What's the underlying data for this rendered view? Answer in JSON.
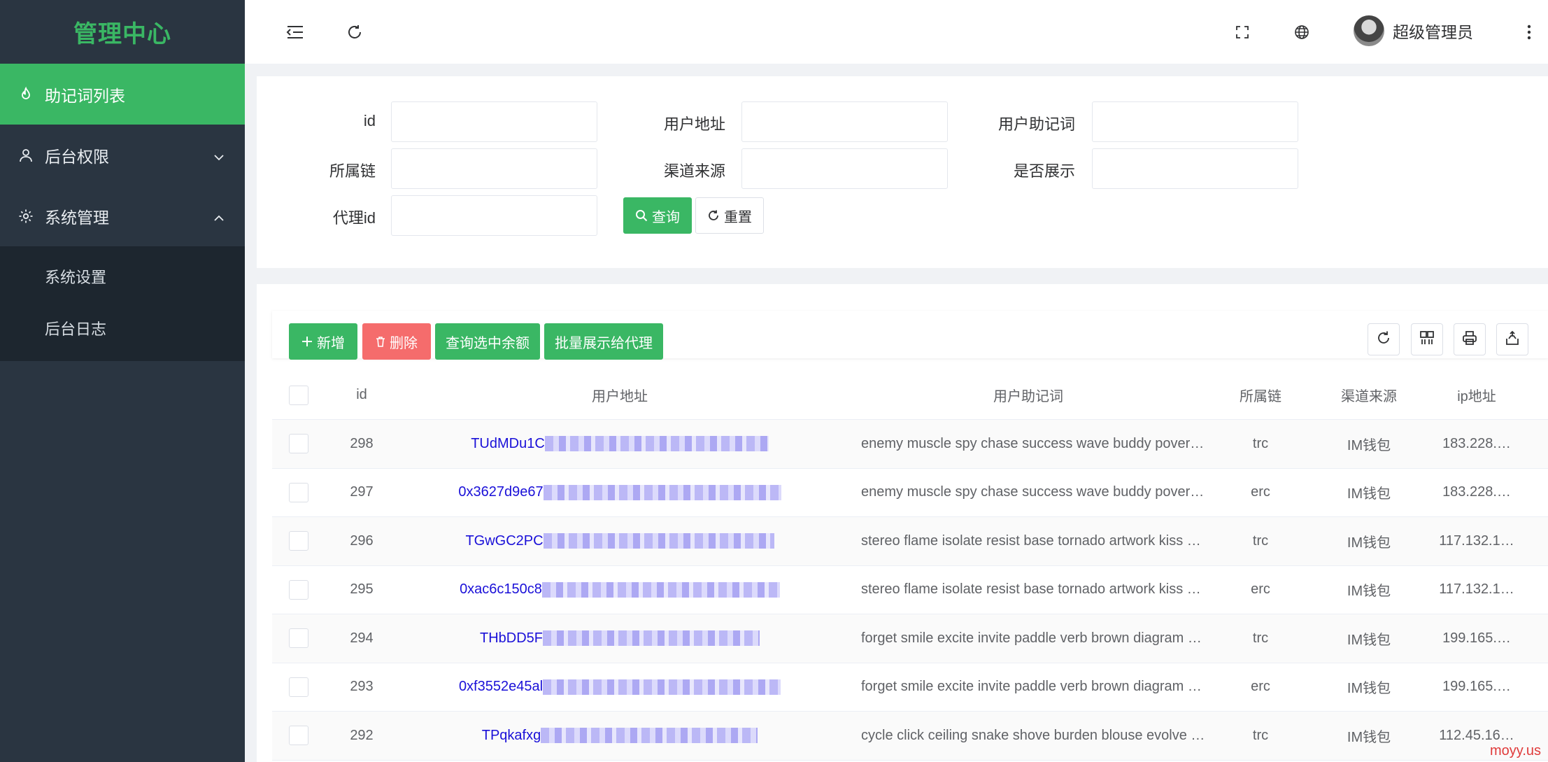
{
  "sidebar": {
    "logo": "管理中心",
    "menu": [
      {
        "label": "助记词列表",
        "icon": "flame-icon",
        "active": true
      },
      {
        "label": "后台权限",
        "icon": "user-icon",
        "expanded": false
      },
      {
        "label": "系统管理",
        "icon": "gear-icon",
        "expanded": true
      }
    ],
    "submenu": [
      {
        "label": "系统设置"
      },
      {
        "label": "后台日志"
      }
    ],
    "colors": {
      "bg": "#2a3541",
      "active": "#3ab764",
      "submenu_bg": "#1d262f"
    }
  },
  "header": {
    "icons": [
      "menu-fold-icon",
      "refresh-icon",
      "fullscreen-icon",
      "globe-icon",
      "more-vertical-icon"
    ],
    "user_name": "超级管理员"
  },
  "search": {
    "fields": [
      {
        "label": "id",
        "value": ""
      },
      {
        "label": "用户地址",
        "value": ""
      },
      {
        "label": "用户助记词",
        "value": ""
      },
      {
        "label": "所属链",
        "value": ""
      },
      {
        "label": "渠道来源",
        "value": ""
      },
      {
        "label": "是否展示",
        "value": ""
      },
      {
        "label": "代理id",
        "value": ""
      }
    ],
    "query_button": "查询",
    "reset_button": "重置"
  },
  "toolbar": {
    "add_button": "新增",
    "delete_button": "删除",
    "query_balance_button": "查询选中余额",
    "batch_show_button": "批量展示给代理",
    "right_icons": [
      "refresh-icon",
      "columns-icon",
      "print-icon",
      "export-icon"
    ]
  },
  "table": {
    "columns": [
      "id",
      "用户地址",
      "用户助记词",
      "所属链",
      "渠道来源",
      "ip地址"
    ],
    "rows": [
      {
        "id": "298",
        "address": "TUdMDu1C",
        "mnemonic": "enemy muscle spy chase success wave buddy pover…",
        "chain": "trc",
        "channel": "IM钱包",
        "ip": "183.228.…"
      },
      {
        "id": "297",
        "address": "0x3627d9e67",
        "mnemonic": "enemy muscle spy chase success wave buddy pover…",
        "chain": "erc",
        "channel": "IM钱包",
        "ip": "183.228.…"
      },
      {
        "id": "296",
        "address": "TGwGC2PC",
        "mnemonic": "stereo flame isolate resist base tornado artwork kiss …",
        "chain": "trc",
        "channel": "IM钱包",
        "ip": "117.132.1…"
      },
      {
        "id": "295",
        "address": "0xac6c150c8",
        "mnemonic": "stereo flame isolate resist base tornado artwork kiss …",
        "chain": "erc",
        "channel": "IM钱包",
        "ip": "117.132.1…"
      },
      {
        "id": "294",
        "address": "THbDD5F",
        "mnemonic": "forget smile excite invite paddle verb brown diagram …",
        "chain": "trc",
        "channel": "IM钱包",
        "ip": "199.165.…"
      },
      {
        "id": "293",
        "address": "0xf3552e45al",
        "mnemonic": "forget smile excite invite paddle verb brown diagram …",
        "chain": "erc",
        "channel": "IM钱包",
        "ip": "199.165.…"
      },
      {
        "id": "292",
        "address": "TPqkafxg",
        "mnemonic": "cycle click ceiling snake shove burden blouse evolve …",
        "chain": "trc",
        "channel": "IM钱包",
        "ip": "112.45.16…"
      }
    ]
  },
  "watermark": "moyy.us",
  "colors": {
    "primary": "#3ab764",
    "danger": "#f56c6c",
    "link": "#1a10d8"
  }
}
